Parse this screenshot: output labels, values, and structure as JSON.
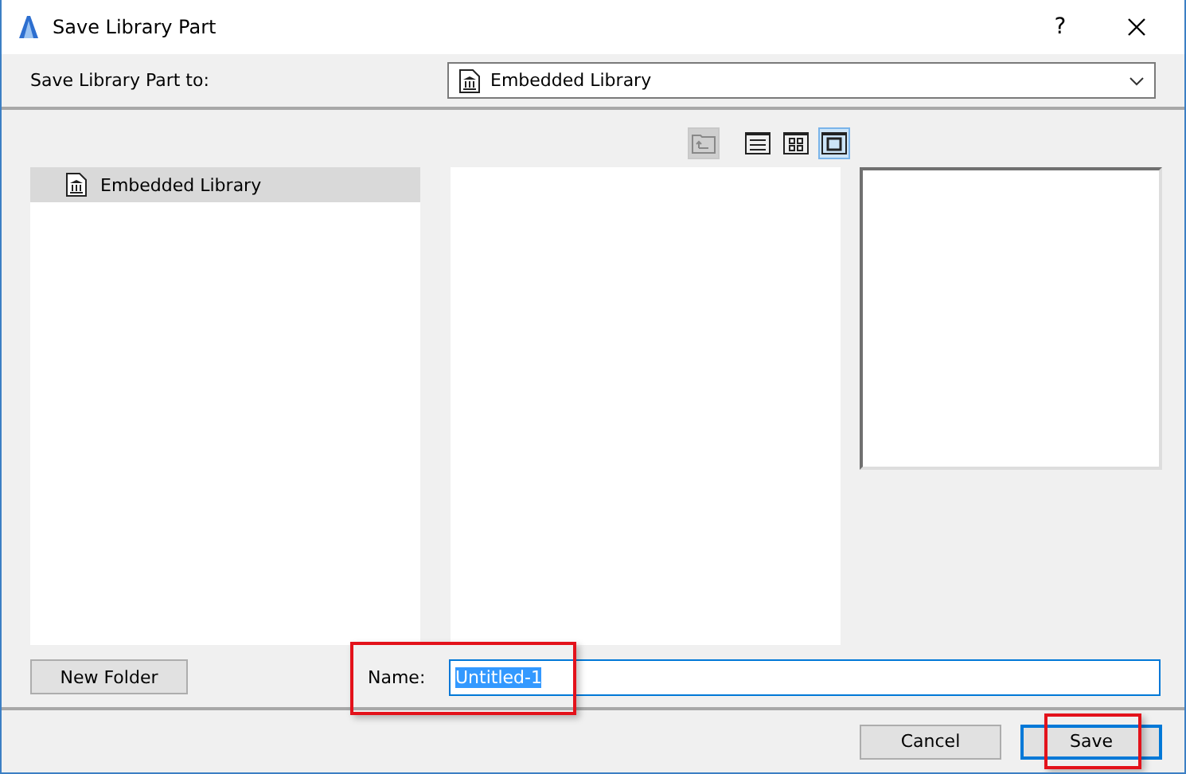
{
  "window": {
    "title": "Save Library Part",
    "help": "?"
  },
  "destination": {
    "label": "Save Library Part to:",
    "value": "Embedded Library"
  },
  "toolbar": [
    {
      "kind": "up",
      "disabled": true,
      "selected": false
    },
    {
      "kind": "list",
      "disabled": false,
      "selected": false
    },
    {
      "kind": "grid",
      "disabled": false,
      "selected": false
    },
    {
      "kind": "preview",
      "disabled": false,
      "selected": true
    }
  ],
  "tree": {
    "items": [
      {
        "label": "Embedded Library",
        "selected": true
      }
    ]
  },
  "new_folder": "New Folder",
  "name": {
    "label": "Name:",
    "value": "Untitled-1",
    "highlighted": true
  },
  "buttons": [
    {
      "label": "Cancel",
      "default": false,
      "highlighted": false
    },
    {
      "label": "Save",
      "default": true,
      "highlighted": true
    }
  ]
}
